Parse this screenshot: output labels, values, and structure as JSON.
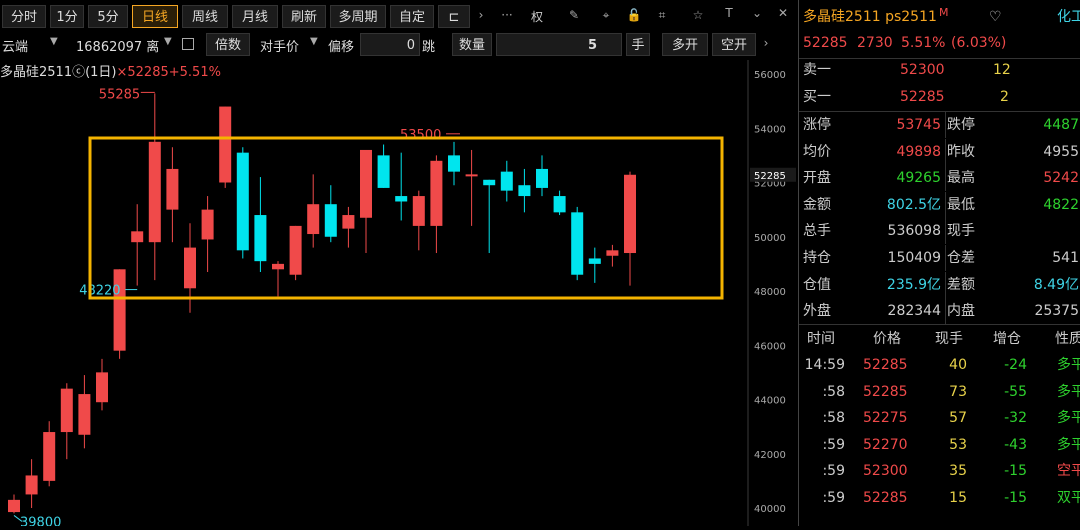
{
  "toolbar1": {
    "buttons": [
      "分时",
      "1分",
      "5分",
      "日线",
      "周线",
      "月线",
      "刷新",
      "多周期",
      "自定"
    ],
    "active": "日线",
    "more": "›",
    "dots": "···",
    "quan": "权"
  },
  "toolbar2": {
    "source": "云端",
    "account": "16862097 离",
    "times_label": "倍数",
    "price_type": "对手价",
    "offset_label": "偏移",
    "offset_value": "0",
    "tick_label": "跳",
    "qty_label": "数量",
    "qty_value": "5",
    "hand_label": "手",
    "buy_open": "多开",
    "sell_open": "空开",
    "more": "›"
  },
  "chart_data": {
    "type": "candlestick",
    "title": "多晶硅2511ⓒ(1日)",
    "close_marker": "×52285+5.51%",
    "ylim": [
      40000,
      56000
    ],
    "yticks": [
      40000,
      42000,
      44000,
      46000,
      48000,
      50000,
      52000,
      54000,
      56000
    ],
    "current_price_label": "52285",
    "candles": [
      {
        "o": 39850,
        "h": 40500,
        "l": 39800,
        "c": 40300
      },
      {
        "o": 40500,
        "h": 41800,
        "l": 40000,
        "c": 41200
      },
      {
        "o": 41000,
        "h": 43200,
        "l": 40800,
        "c": 42800
      },
      {
        "o": 42800,
        "h": 44600,
        "l": 41800,
        "c": 44400
      },
      {
        "o": 42700,
        "h": 44900,
        "l": 42200,
        "c": 44200
      },
      {
        "o": 43900,
        "h": 45500,
        "l": 43600,
        "c": 45000
      },
      {
        "o": 45800,
        "h": 48800,
        "l": 45500,
        "c": 48800
      },
      {
        "o": 49800,
        "h": 51200,
        "l": 48200,
        "c": 50200
      },
      {
        "o": 49800,
        "h": 55285,
        "l": 48400,
        "c": 53500
      },
      {
        "o": 51000,
        "h": 53300,
        "l": 49800,
        "c": 52500
      },
      {
        "o": 48100,
        "h": 50500,
        "l": 47200,
        "c": 49600
      },
      {
        "o": 49900,
        "h": 51500,
        "l": 48700,
        "c": 51000
      },
      {
        "o": 52000,
        "h": 54800,
        "l": 51800,
        "c": 54800
      },
      {
        "o": 53100,
        "h": 53300,
        "l": 49200,
        "c": 49500
      },
      {
        "o": 50800,
        "h": 52200,
        "l": 48700,
        "c": 49100
      },
      {
        "o": 48800,
        "h": 49100,
        "l": 47800,
        "c": 49000
      },
      {
        "o": 48600,
        "h": 50400,
        "l": 48400,
        "c": 50400
      },
      {
        "o": 50100,
        "h": 52300,
        "l": 49600,
        "c": 51200
      },
      {
        "o": 51200,
        "h": 51900,
        "l": 49800,
        "c": 50000
      },
      {
        "o": 50300,
        "h": 51100,
        "l": 49600,
        "c": 50800
      },
      {
        "o": 50700,
        "h": 53200,
        "l": 49400,
        "c": 53200
      },
      {
        "o": 53000,
        "h": 53400,
        "l": 51800,
        "c": 51800
      },
      {
        "o": 51500,
        "h": 53100,
        "l": 50600,
        "c": 51300
      },
      {
        "o": 50400,
        "h": 51700,
        "l": 49500,
        "c": 51500
      },
      {
        "o": 50400,
        "h": 53000,
        "l": 49400,
        "c": 52800
      },
      {
        "o": 53000,
        "h": 53500,
        "l": 51900,
        "c": 52400
      },
      {
        "o": 52300,
        "h": 53200,
        "l": 50400,
        "c": 52300
      },
      {
        "o": 52100,
        "h": 52100,
        "l": 49400,
        "c": 51900
      },
      {
        "o": 52400,
        "h": 52800,
        "l": 51300,
        "c": 51700
      },
      {
        "o": 51900,
        "h": 52500,
        "l": 50900,
        "c": 51500
      },
      {
        "o": 52500,
        "h": 53000,
        "l": 51500,
        "c": 51800
      },
      {
        "o": 51500,
        "h": 51700,
        "l": 50800,
        "c": 50900
      },
      {
        "o": 50900,
        "h": 51100,
        "l": 48400,
        "c": 48600
      },
      {
        "o": 49200,
        "h": 49600,
        "l": 48300,
        "c": 49000
      },
      {
        "o": 49300,
        "h": 49700,
        "l": 48900,
        "c": 49500
      },
      {
        "o": 49400,
        "h": 52400,
        "l": 48200,
        "c": 52285
      }
    ],
    "annotations": {
      "high1": "55285",
      "high2": "53500",
      "low1": "48220",
      "low2": "39800"
    },
    "box_color": "#f5b400"
  },
  "right": {
    "title": "多晶硅2511 ps2511",
    "title_sup": "M",
    "category": "化工",
    "price": "52285",
    "change": "2730",
    "pct": "5.51%",
    "pct2": "(6.03%)",
    "sell1_label": "卖一",
    "sell1_price": "52300",
    "sell1_qty": "12",
    "buy1_label": "买一",
    "buy1_price": "52285",
    "buy1_qty": "2",
    "stats": [
      [
        "涨停",
        "53745",
        "跌停",
        "4487"
      ],
      [
        "均价",
        "49898",
        "昨收",
        "4955"
      ],
      [
        "开盘",
        "49265",
        "最高",
        "5242"
      ],
      [
        "金额",
        "802.5亿",
        "最低",
        "4822"
      ],
      [
        "总手",
        "536098",
        "现手",
        ""
      ],
      [
        "持仓",
        "150409",
        "仓差",
        "541"
      ],
      [
        "仓值",
        "235.9亿",
        "差额",
        "8.49亿"
      ],
      [
        "外盘",
        "282344",
        "内盘",
        "25375"
      ]
    ],
    "ticks_header": [
      "时间",
      "价格",
      "现手",
      "增仓",
      "性质"
    ],
    "ticks": [
      [
        "14:59",
        "52285",
        "40",
        "-24",
        "多平"
      ],
      [
        ":58",
        "52285",
        "73",
        "-55",
        "多平"
      ],
      [
        ":58",
        "52275",
        "57",
        "-32",
        "多平"
      ],
      [
        ":59",
        "52270",
        "53",
        "-43",
        "多平"
      ],
      [
        ":59",
        "52300",
        "35",
        "-15",
        "空平"
      ],
      [
        ":59",
        "52285",
        "15",
        "-15",
        "双平"
      ]
    ]
  }
}
